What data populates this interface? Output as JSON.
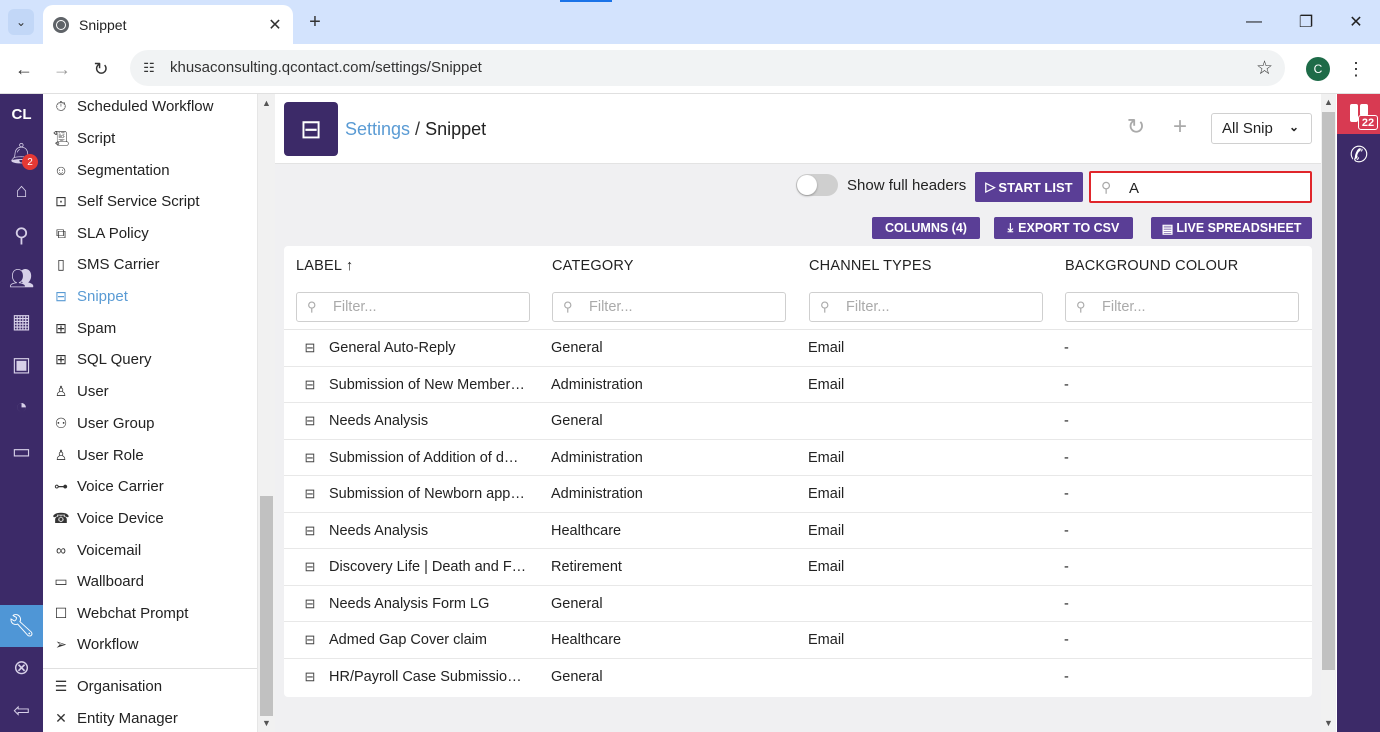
{
  "browser": {
    "tab_title": "Snippet",
    "url": "khusaconsulting.qcontact.com/settings/Snippet",
    "profile_initial": "C"
  },
  "rail": {
    "logo": "CL",
    "notification_count": "2"
  },
  "sidemenu": {
    "items": [
      {
        "label": "Scheduled Workflow",
        "icon": "scheduled-workflow-icon"
      },
      {
        "label": "Script",
        "icon": "script-icon"
      },
      {
        "label": "Segmentation",
        "icon": "segmentation-icon"
      },
      {
        "label": "Self Service Script",
        "icon": "robot-icon"
      },
      {
        "label": "SLA Policy",
        "icon": "sla-icon"
      },
      {
        "label": "SMS Carrier",
        "icon": "phone-icon"
      },
      {
        "label": "Snippet",
        "icon": "snippet-icon",
        "active": true
      },
      {
        "label": "Spam",
        "icon": "spam-icon"
      },
      {
        "label": "SQL Query",
        "icon": "table-icon"
      },
      {
        "label": "User",
        "icon": "user-icon"
      },
      {
        "label": "User Group",
        "icon": "user-group-icon"
      },
      {
        "label": "User Role",
        "icon": "user-role-icon"
      },
      {
        "label": "Voice Carrier",
        "icon": "network-icon"
      },
      {
        "label": "Voice Device",
        "icon": "device-icon"
      },
      {
        "label": "Voicemail",
        "icon": "voicemail-icon"
      },
      {
        "label": "Wallboard",
        "icon": "monitor-icon"
      },
      {
        "label": "Webchat Prompt",
        "icon": "chat-icon"
      },
      {
        "label": "Workflow",
        "icon": "send-icon"
      }
    ],
    "footer_items": [
      {
        "label": "Organisation",
        "icon": "sliders-icon"
      },
      {
        "label": "Entity Manager",
        "icon": "tools-icon"
      }
    ]
  },
  "header": {
    "breadcrumb_parent": "Settings",
    "breadcrumb_sep": "/",
    "breadcrumb_current": "Snippet",
    "view_select": "All Snip"
  },
  "toolbar": {
    "toggle_label": "Show full headers",
    "start_list": "START LIST",
    "search_value": "A",
    "columns": "COLUMNS (4)",
    "export": "EXPORT TO CSV",
    "live": "LIVE SPREADSHEET"
  },
  "table": {
    "columns": [
      "LABEL",
      "CATEGORY",
      "CHANNEL TYPES",
      "BACKGROUND COLOUR"
    ],
    "filter_placeholder": "Filter...",
    "rows": [
      {
        "label": "General Auto-Reply",
        "category": "General",
        "channel": "Email",
        "bg": "-"
      },
      {
        "label": "Submission of New Member…",
        "category": "Administration",
        "channel": "Email",
        "bg": "-"
      },
      {
        "label": "Needs Analysis",
        "category": "General",
        "channel": "",
        "bg": "-"
      },
      {
        "label": "Submission of Addition of d…",
        "category": "Administration",
        "channel": "Email",
        "bg": "-"
      },
      {
        "label": "Submission of Newborn app…",
        "category": "Administration",
        "channel": "Email",
        "bg": "-"
      },
      {
        "label": "Needs Analysis",
        "category": "Healthcare",
        "channel": "Email",
        "bg": "-"
      },
      {
        "label": "Discovery Life | Death and F…",
        "category": "Retirement",
        "channel": "Email",
        "bg": "-"
      },
      {
        "label": "Needs Analysis Form LG",
        "category": "General",
        "channel": "",
        "bg": "-"
      },
      {
        "label": "Admed Gap Cover claim",
        "category": "Healthcare",
        "channel": "Email",
        "bg": "-"
      },
      {
        "label": "HR/Payroll Case Submissio…",
        "category": "General",
        "channel": "",
        "bg": "-"
      }
    ]
  },
  "rightbar": {
    "badge": "22"
  },
  "colors": {
    "brand_purple": "#3c2a68",
    "button_purple": "#5a3e96",
    "accent_blue": "#5a9bd4",
    "search_highlight": "#e0262b"
  }
}
